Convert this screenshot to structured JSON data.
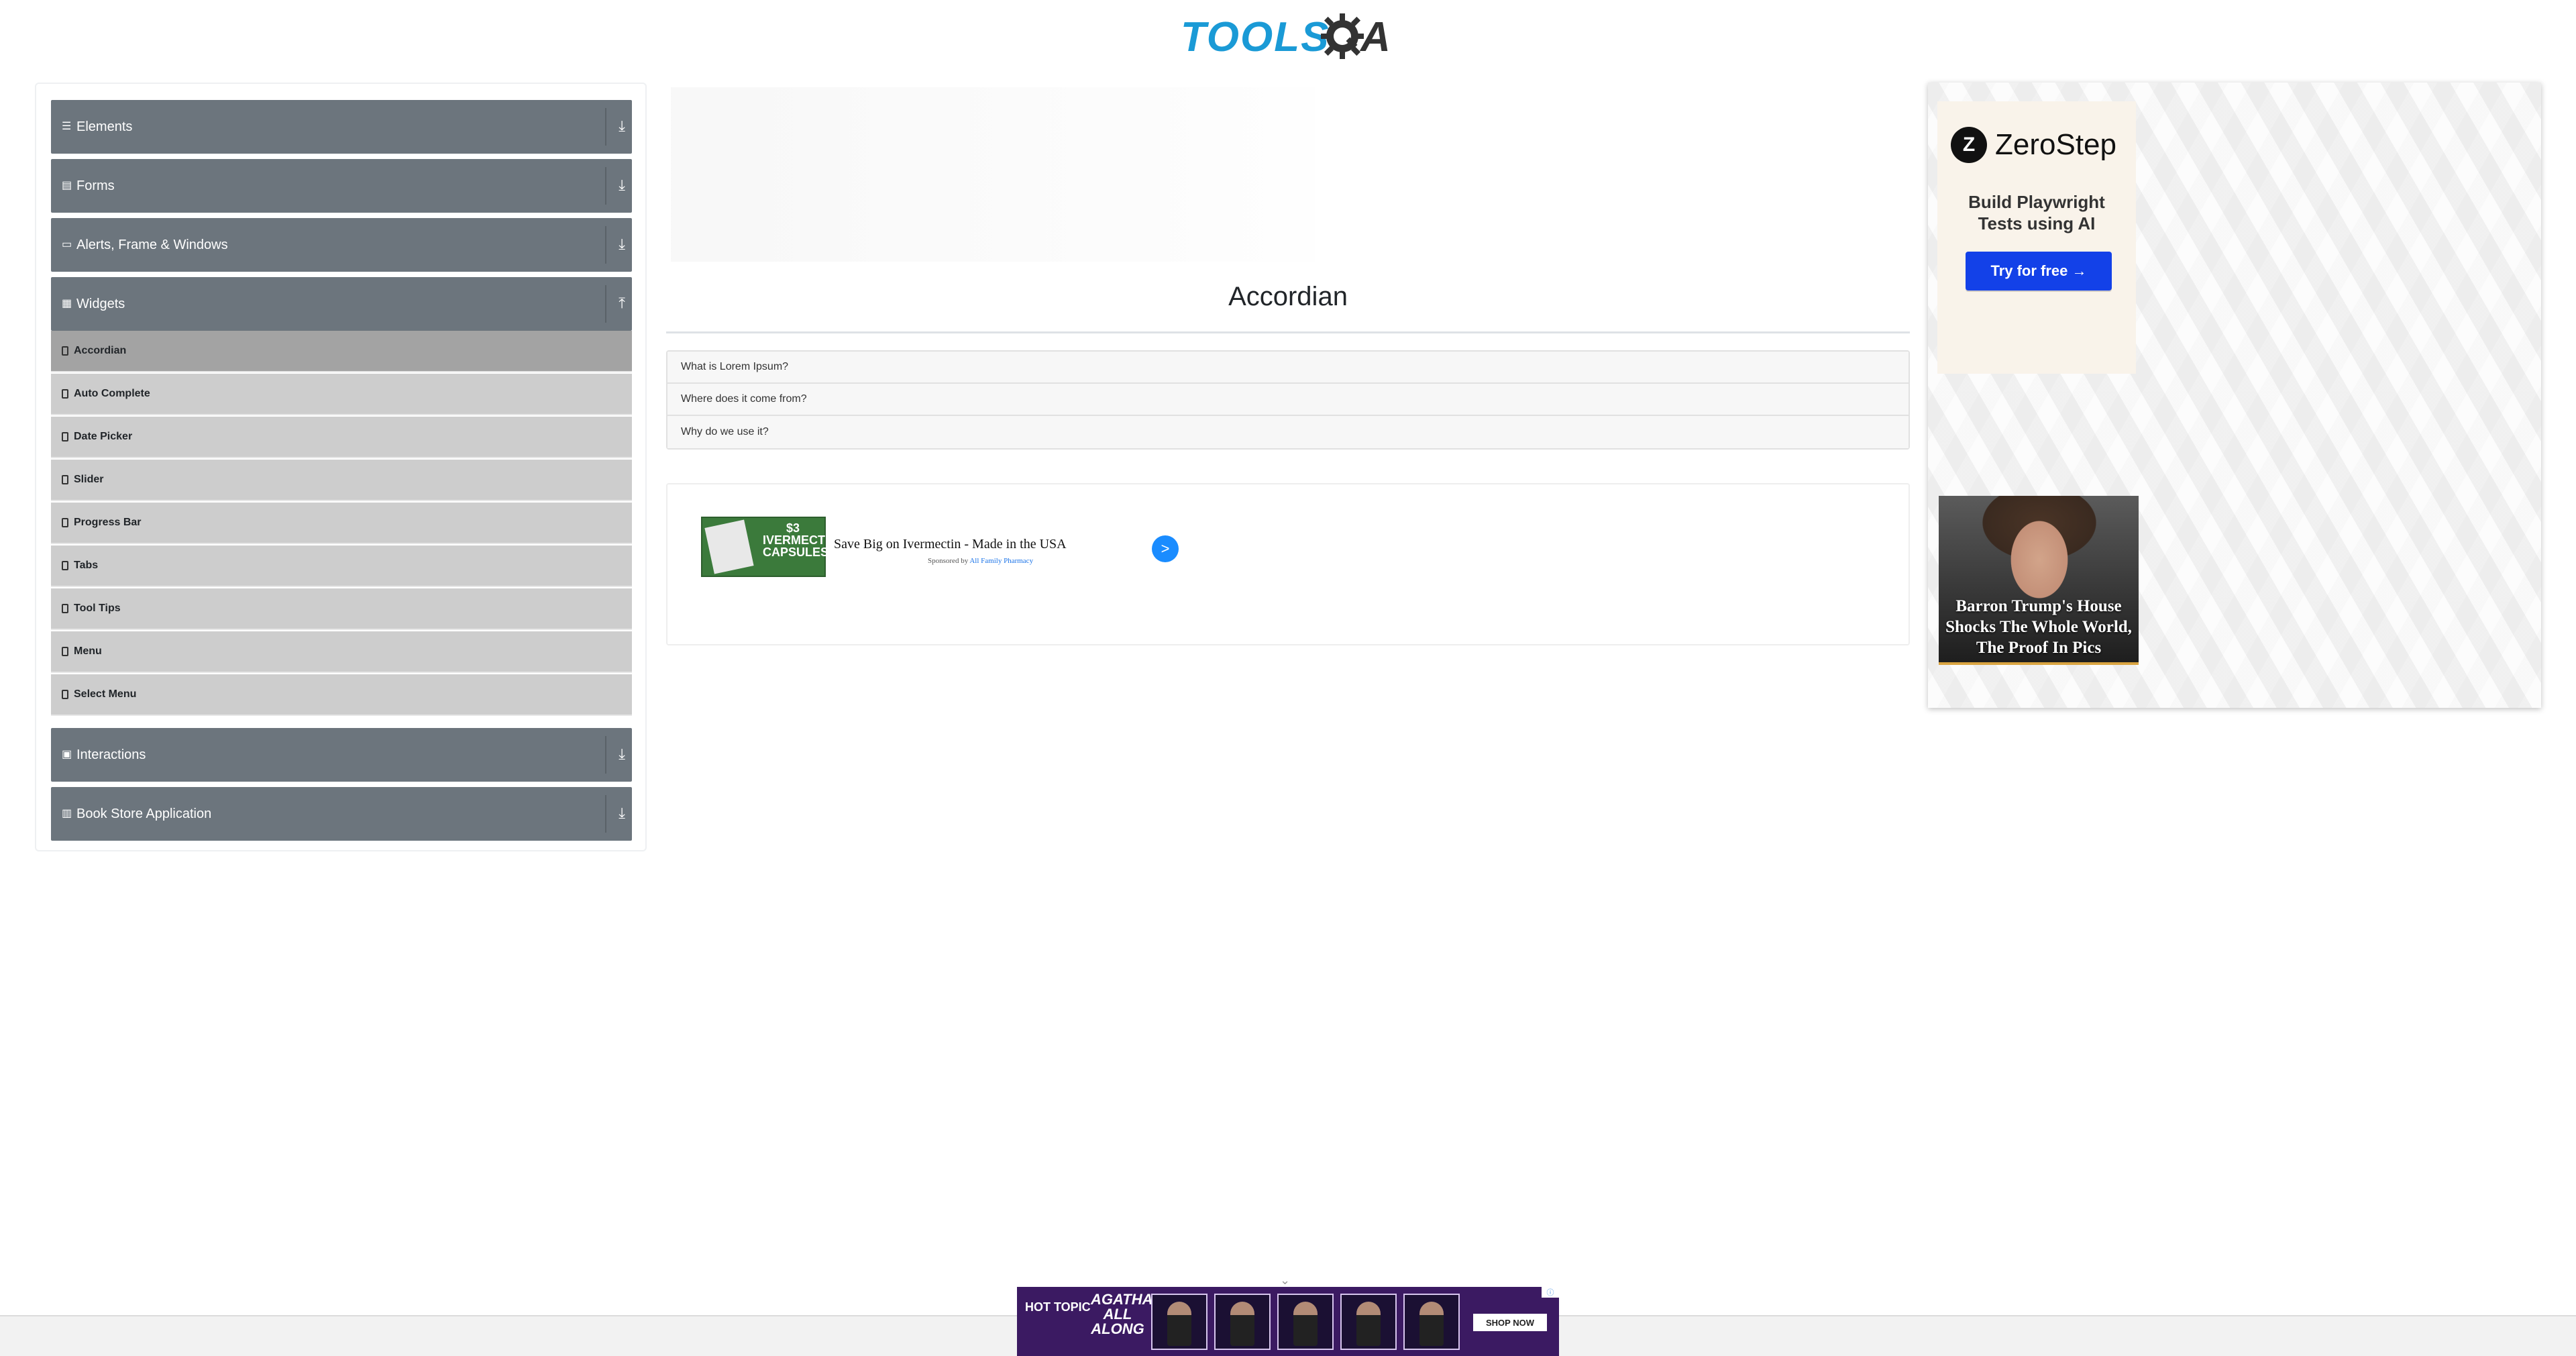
{
  "header": {
    "logo_text": "TOOLS",
    "logo_suffix": "A"
  },
  "sidebar": {
    "groups": [
      {
        "label": "Elements",
        "icon": "list-icon"
      },
      {
        "label": "Forms",
        "icon": "doc-icon"
      },
      {
        "label": "Alerts, Frame & Windows",
        "icon": "window-icon"
      },
      {
        "label": "Widgets",
        "icon": "grid-icon",
        "expanded": true
      },
      {
        "label": "Interactions",
        "icon": "box-icon"
      },
      {
        "label": "Book Store Application",
        "icon": "book-icon"
      }
    ],
    "widgets_items": [
      {
        "label": "Accordian",
        "active": true
      },
      {
        "label": "Auto Complete"
      },
      {
        "label": "Date Picker"
      },
      {
        "label": "Slider"
      },
      {
        "label": "Progress Bar"
      },
      {
        "label": "Tabs"
      },
      {
        "label": "Tool Tips"
      },
      {
        "label": "Menu"
      },
      {
        "label": "Select Menu"
      }
    ]
  },
  "main": {
    "title": "Accordian",
    "accordion": [
      {
        "label": "What is Lorem Ipsum?"
      },
      {
        "label": "Where does it come from?"
      },
      {
        "label": "Why do we use it?"
      }
    ],
    "ad": {
      "thumb_text": "$3 IVERMECTIN CAPSULES",
      "headline": "Save Big on Ivermectin - Made in the USA",
      "sponsor_prefix": "Sponsored by",
      "sponsor_name": "All Family Pharmacy",
      "go_label": ">"
    }
  },
  "right_ads": {
    "zerostep": {
      "logo": "Z",
      "name": "ZeroStep",
      "tagline_1": "Build Playwright",
      "tagline_2": "Tests using AI",
      "button": "Try for free →"
    },
    "news": {
      "caption": "Barron Trump's House Shocks The Whole World, The Proof In Pics"
    }
  },
  "bottom_ad": {
    "brand": "HOT TOPIC",
    "show": "AGATHA ALL ALONG",
    "shop": "SHOP NOW",
    "chevron": "⌄"
  },
  "colors": {
    "sidebar_header": "#6c757d",
    "sidebar_item": "#cdcdcd",
    "sidebar_item_active": "#a3a3a3",
    "brand_blue": "#1a9ad6",
    "cta_blue": "#1341e8"
  }
}
